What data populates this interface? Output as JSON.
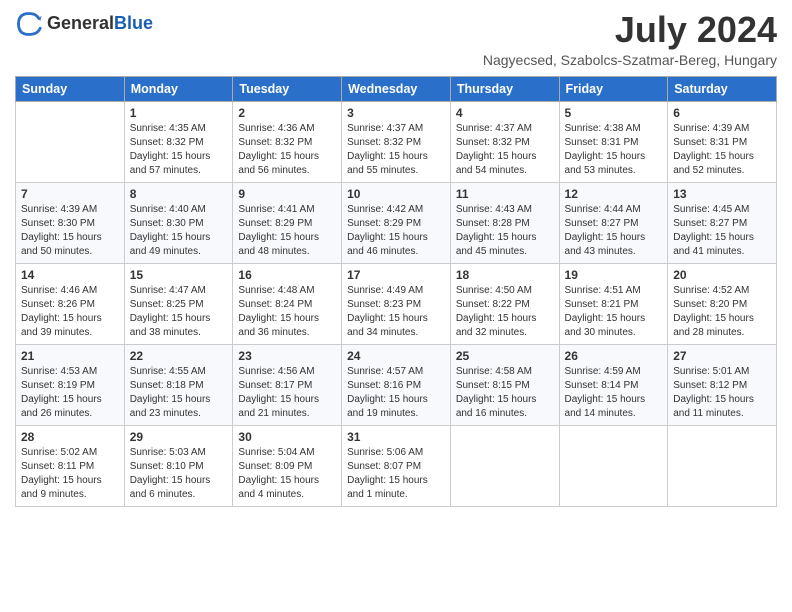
{
  "logo": {
    "general": "General",
    "blue": "Blue"
  },
  "title": "July 2024",
  "subtitle": "Nagyecsed, Szabolcs-Szatmar-Bereg, Hungary",
  "weekdays": [
    "Sunday",
    "Monday",
    "Tuesday",
    "Wednesday",
    "Thursday",
    "Friday",
    "Saturday"
  ],
  "weeks": [
    [
      {
        "day": null
      },
      {
        "day": 1,
        "sunrise": "4:35 AM",
        "sunset": "8:32 PM",
        "daylight": "15 hours and 57 minutes."
      },
      {
        "day": 2,
        "sunrise": "4:36 AM",
        "sunset": "8:32 PM",
        "daylight": "15 hours and 56 minutes."
      },
      {
        "day": 3,
        "sunrise": "4:37 AM",
        "sunset": "8:32 PM",
        "daylight": "15 hours and 55 minutes."
      },
      {
        "day": 4,
        "sunrise": "4:37 AM",
        "sunset": "8:32 PM",
        "daylight": "15 hours and 54 minutes."
      },
      {
        "day": 5,
        "sunrise": "4:38 AM",
        "sunset": "8:31 PM",
        "daylight": "15 hours and 53 minutes."
      },
      {
        "day": 6,
        "sunrise": "4:39 AM",
        "sunset": "8:31 PM",
        "daylight": "15 hours and 52 minutes."
      }
    ],
    [
      {
        "day": 7,
        "sunrise": "4:39 AM",
        "sunset": "8:30 PM",
        "daylight": "15 hours and 50 minutes."
      },
      {
        "day": 8,
        "sunrise": "4:40 AM",
        "sunset": "8:30 PM",
        "daylight": "15 hours and 49 minutes."
      },
      {
        "day": 9,
        "sunrise": "4:41 AM",
        "sunset": "8:29 PM",
        "daylight": "15 hours and 48 minutes."
      },
      {
        "day": 10,
        "sunrise": "4:42 AM",
        "sunset": "8:29 PM",
        "daylight": "15 hours and 46 minutes."
      },
      {
        "day": 11,
        "sunrise": "4:43 AM",
        "sunset": "8:28 PM",
        "daylight": "15 hours and 45 minutes."
      },
      {
        "day": 12,
        "sunrise": "4:44 AM",
        "sunset": "8:27 PM",
        "daylight": "15 hours and 43 minutes."
      },
      {
        "day": 13,
        "sunrise": "4:45 AM",
        "sunset": "8:27 PM",
        "daylight": "15 hours and 41 minutes."
      }
    ],
    [
      {
        "day": 14,
        "sunrise": "4:46 AM",
        "sunset": "8:26 PM",
        "daylight": "15 hours and 39 minutes."
      },
      {
        "day": 15,
        "sunrise": "4:47 AM",
        "sunset": "8:25 PM",
        "daylight": "15 hours and 38 minutes."
      },
      {
        "day": 16,
        "sunrise": "4:48 AM",
        "sunset": "8:24 PM",
        "daylight": "15 hours and 36 minutes."
      },
      {
        "day": 17,
        "sunrise": "4:49 AM",
        "sunset": "8:23 PM",
        "daylight": "15 hours and 34 minutes."
      },
      {
        "day": 18,
        "sunrise": "4:50 AM",
        "sunset": "8:22 PM",
        "daylight": "15 hours and 32 minutes."
      },
      {
        "day": 19,
        "sunrise": "4:51 AM",
        "sunset": "8:21 PM",
        "daylight": "15 hours and 30 minutes."
      },
      {
        "day": 20,
        "sunrise": "4:52 AM",
        "sunset": "8:20 PM",
        "daylight": "15 hours and 28 minutes."
      }
    ],
    [
      {
        "day": 21,
        "sunrise": "4:53 AM",
        "sunset": "8:19 PM",
        "daylight": "15 hours and 26 minutes."
      },
      {
        "day": 22,
        "sunrise": "4:55 AM",
        "sunset": "8:18 PM",
        "daylight": "15 hours and 23 minutes."
      },
      {
        "day": 23,
        "sunrise": "4:56 AM",
        "sunset": "8:17 PM",
        "daylight": "15 hours and 21 minutes."
      },
      {
        "day": 24,
        "sunrise": "4:57 AM",
        "sunset": "8:16 PM",
        "daylight": "15 hours and 19 minutes."
      },
      {
        "day": 25,
        "sunrise": "4:58 AM",
        "sunset": "8:15 PM",
        "daylight": "15 hours and 16 minutes."
      },
      {
        "day": 26,
        "sunrise": "4:59 AM",
        "sunset": "8:14 PM",
        "daylight": "15 hours and 14 minutes."
      },
      {
        "day": 27,
        "sunrise": "5:01 AM",
        "sunset": "8:12 PM",
        "daylight": "15 hours and 11 minutes."
      }
    ],
    [
      {
        "day": 28,
        "sunrise": "5:02 AM",
        "sunset": "8:11 PM",
        "daylight": "15 hours and 9 minutes."
      },
      {
        "day": 29,
        "sunrise": "5:03 AM",
        "sunset": "8:10 PM",
        "daylight": "15 hours and 6 minutes."
      },
      {
        "day": 30,
        "sunrise": "5:04 AM",
        "sunset": "8:09 PM",
        "daylight": "15 hours and 4 minutes."
      },
      {
        "day": 31,
        "sunrise": "5:06 AM",
        "sunset": "8:07 PM",
        "daylight": "15 hours and 1 minute."
      },
      {
        "day": null
      },
      {
        "day": null
      },
      {
        "day": null
      }
    ]
  ]
}
